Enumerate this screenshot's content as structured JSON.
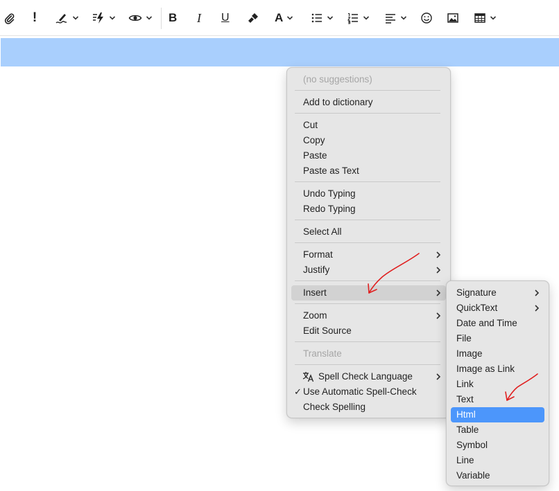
{
  "toolbar": {
    "icons": [
      {
        "name": "paperclip-icon",
        "label": "attach"
      },
      {
        "name": "exclamation-icon",
        "label": "!"
      },
      {
        "name": "signature-pen-icon",
        "label": "signature"
      },
      {
        "name": "quick-actions-icon",
        "label": "quick actions"
      },
      {
        "name": "eye-icon",
        "label": "preview"
      },
      {
        "name": "bold-icon",
        "label": "B"
      },
      {
        "name": "italic-icon",
        "label": "I"
      },
      {
        "name": "underline-icon",
        "label": "U"
      },
      {
        "name": "paintbrush-icon",
        "label": "format painter"
      },
      {
        "name": "font-icon",
        "label": "A"
      },
      {
        "name": "bulleted-list-icon",
        "label": "bullets"
      },
      {
        "name": "numbered-list-icon",
        "label": "numbering"
      },
      {
        "name": "align-left-icon",
        "label": "align"
      },
      {
        "name": "smiley-icon",
        "label": "emoji"
      },
      {
        "name": "image-icon",
        "label": "image"
      },
      {
        "name": "table-icon",
        "label": "table"
      }
    ],
    "bold_glyph": "B",
    "italic_glyph": "I",
    "underline_glyph": "U",
    "font_glyph": "A",
    "exclamation_glyph": "!"
  },
  "context_menu": {
    "no_suggestions": "(no suggestions)",
    "add_to_dictionary": "Add to dictionary",
    "cut": "Cut",
    "copy": "Copy",
    "paste": "Paste",
    "paste_as_text": "Paste as Text",
    "undo_typing": "Undo Typing",
    "redo_typing": "Redo Typing",
    "select_all": "Select All",
    "format": "Format",
    "justify": "Justify",
    "insert": "Insert",
    "zoom": "Zoom",
    "edit_source": "Edit Source",
    "translate": "Translate",
    "spell_check_language": "Spell Check Language",
    "use_automatic_spell_check": "Use Automatic Spell-Check",
    "check_spelling": "Check Spelling",
    "checkmark": "✓"
  },
  "insert_submenu": {
    "signature": "Signature",
    "quicktext": "QuickText",
    "date_and_time": "Date and Time",
    "file": "File",
    "image": "Image",
    "image_as_link": "Image as Link",
    "link": "Link",
    "text": "Text",
    "html": "Html",
    "table": "Table",
    "symbol": "Symbol",
    "line": "Line",
    "variable": "Variable"
  },
  "colors": {
    "selection_highlight": "#a9cffd",
    "menu_selected": "#4c96fb",
    "annotation": "#e02020"
  }
}
